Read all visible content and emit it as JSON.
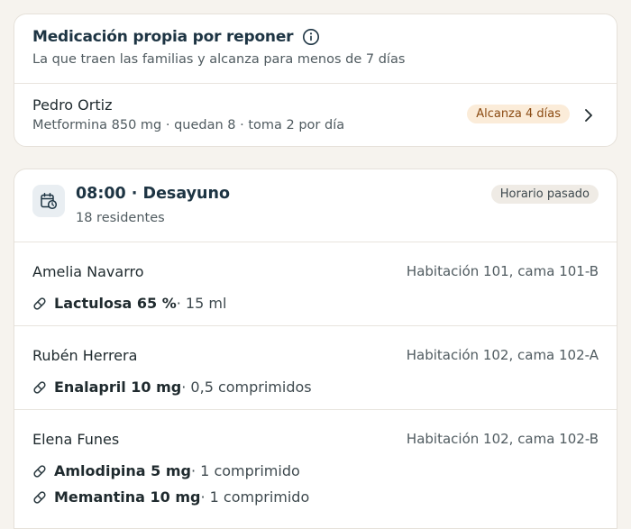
{
  "colors": {
    "background": "#f6f3ee",
    "card": "#ffffff",
    "title": "#1d3443",
    "warn_badge_bg": "#fbecd9",
    "warn_badge_text": "#8a4a12",
    "past_badge_bg": "#efebe5"
  },
  "own_meds": {
    "title": "Medicación propia por reponer",
    "info_icon": "info-icon",
    "subtitle": "La que traen las familias y alcanza para menos de 7 días",
    "items": [
      {
        "name": "Pedro Ortiz",
        "detail": "Metformina 850 mg · quedan 8 · toma 2 por día",
        "badge": "Alcanza 4 días",
        "icon": "chevron-right-icon"
      }
    ]
  },
  "schedule": {
    "icon": "calendar-clock-icon",
    "title": "08:00 · Desayuno",
    "subtitle": "18 residentes",
    "badge": "Horario pasado",
    "residents": [
      {
        "name": "Amelia Navarro",
        "room": "Habitación 101, cama 101-B",
        "meds": [
          {
            "icon": "pill-icon",
            "name": "Lactulosa 65 %",
            "dose": " · 15 ml"
          }
        ]
      },
      {
        "name": "Rubén Herrera",
        "room": "Habitación 102, cama 102-A",
        "meds": [
          {
            "icon": "pill-icon",
            "name": "Enalapril 10 mg",
            "dose": " · 0,5 comprimidos"
          }
        ]
      },
      {
        "name": "Elena Funes",
        "room": "Habitación 102, cama 102-B",
        "meds": [
          {
            "icon": "pill-icon",
            "name": "Amlodipina 5 mg",
            "dose": " · 1 comprimido"
          },
          {
            "icon": "pill-icon",
            "name": "Memantina 10 mg",
            "dose": " · 1 comprimido"
          }
        ]
      }
    ]
  }
}
